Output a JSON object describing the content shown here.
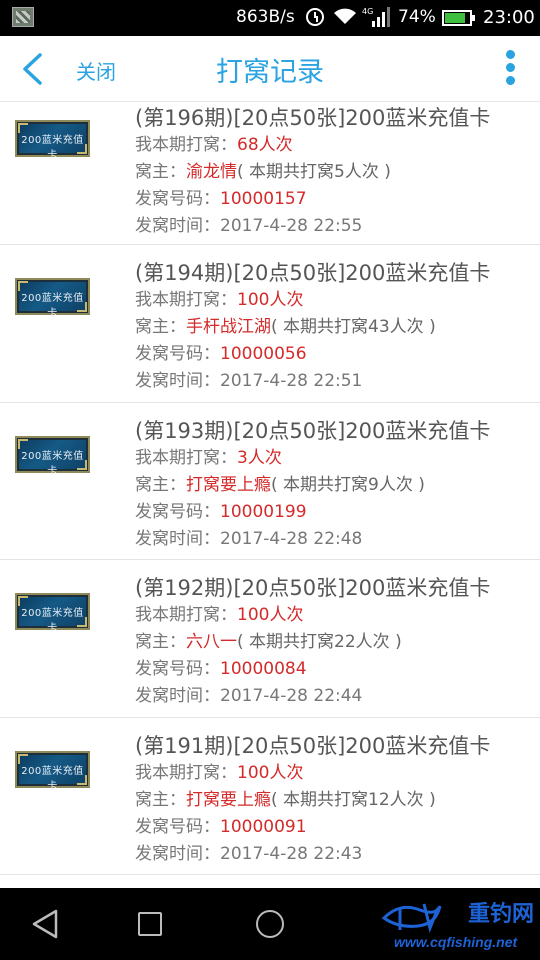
{
  "status_bar": {
    "network_speed": "863B/s",
    "battery_percent": "74%",
    "time": "23:00",
    "network_type": "4G"
  },
  "header": {
    "close_label": "关闭",
    "title": "打窝记录"
  },
  "labels": {
    "my_bets": "我本期打窝：",
    "host": "窝主：",
    "number": "发窝号码：",
    "time": "发窝时间："
  },
  "records": [
    {
      "thumb_text": "200蓝米充值卡",
      "title": "(第196期)[20点50张]200蓝米充值卡",
      "my_bets": "68人次",
      "host": "渝龙情",
      "host_note": "( 本期共打窝5人次 )",
      "number": "10000157",
      "time": "2017-4-28 22:55"
    },
    {
      "thumb_text": "200蓝米充值卡",
      "title": "(第194期)[20点50张]200蓝米充值卡",
      "my_bets": "100人次",
      "host": "手杆战江湖",
      "host_note": "( 本期共打窝43人次 )",
      "number": "10000056",
      "time": "2017-4-28 22:51"
    },
    {
      "thumb_text": "200蓝米充值卡",
      "title": "(第193期)[20点50张]200蓝米充值卡",
      "my_bets": "3人次",
      "host": "打窝要上瘾",
      "host_note": "( 本期共打窝9人次 )",
      "number": "10000199",
      "time": "2017-4-28 22:48"
    },
    {
      "thumb_text": "200蓝米充值卡",
      "title": "(第192期)[20点50张]200蓝米充值卡",
      "my_bets": "100人次",
      "host": "六八一",
      "host_note": "( 本期共打窝22人次 )",
      "number": "10000084",
      "time": "2017-4-28 22:44"
    },
    {
      "thumb_text": "200蓝米充值卡",
      "title": "(第191期)[20点50张]200蓝米充值卡",
      "my_bets": "100人次",
      "host": "打窝要上瘾",
      "host_note": "( 本期共打窝12人次 )",
      "number": "10000091",
      "time": "2017-4-28 22:43"
    }
  ],
  "watermark": {
    "name": "重钓网",
    "url": "www.cqfishing.net"
  },
  "colors": {
    "accent": "#2aa3e0",
    "highlight_red": "#d42a2a",
    "text_gray": "#777777"
  }
}
